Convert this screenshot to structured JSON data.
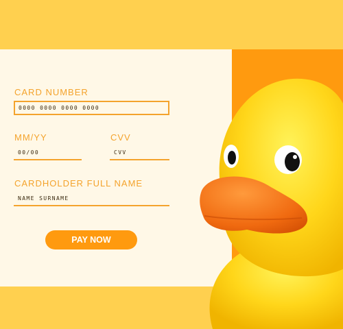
{
  "form": {
    "card_number_label": "CARD  NUMBER",
    "card_number_placeholder": "0000 0000 0000 0000",
    "expiry_label": "MM/YY",
    "expiry_placeholder": "00/00",
    "cvv_label": "CVV",
    "cvv_placeholder": "CVV",
    "name_label": "CARDHOLDER  FULL  NAME",
    "name_placeholder": "NAME SURNAME",
    "pay_label": "PAY NOW"
  },
  "colors": {
    "background": "#ffd04f",
    "panel": "#fff8e7",
    "accent": "#ff9a0f",
    "label": "#f4a32c"
  },
  "illustration": "rubber-duck"
}
